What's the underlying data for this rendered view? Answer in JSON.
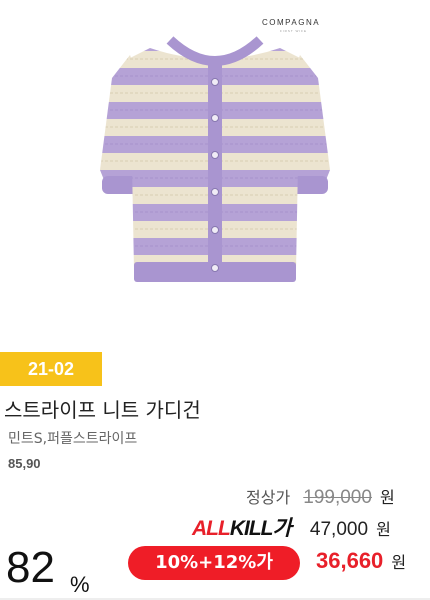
{
  "brand": {
    "name": "COMPAGNA",
    "sub": "FIRST WIFE"
  },
  "product": {
    "code": "21-02",
    "title": "스트라이프 니트 가디건",
    "options": "민트S,퍼플스트라이프",
    "sizes": "85,90",
    "colors": {
      "lavender": "#b5a2d6",
      "cream": "#ece4d0"
    }
  },
  "price": {
    "regular_label": "정상가",
    "regular": "199,000",
    "allkill_logo_all": "ALL",
    "allkill_logo_kill": "KILL가",
    "allkill": "47,000",
    "currency": "원",
    "discount_percent": "82",
    "percent_sign": "%",
    "coupon": "10%+12%가",
    "final": "36,660"
  },
  "accent": {
    "red": "#ef1d27",
    "yellow": "#f7c21a"
  }
}
